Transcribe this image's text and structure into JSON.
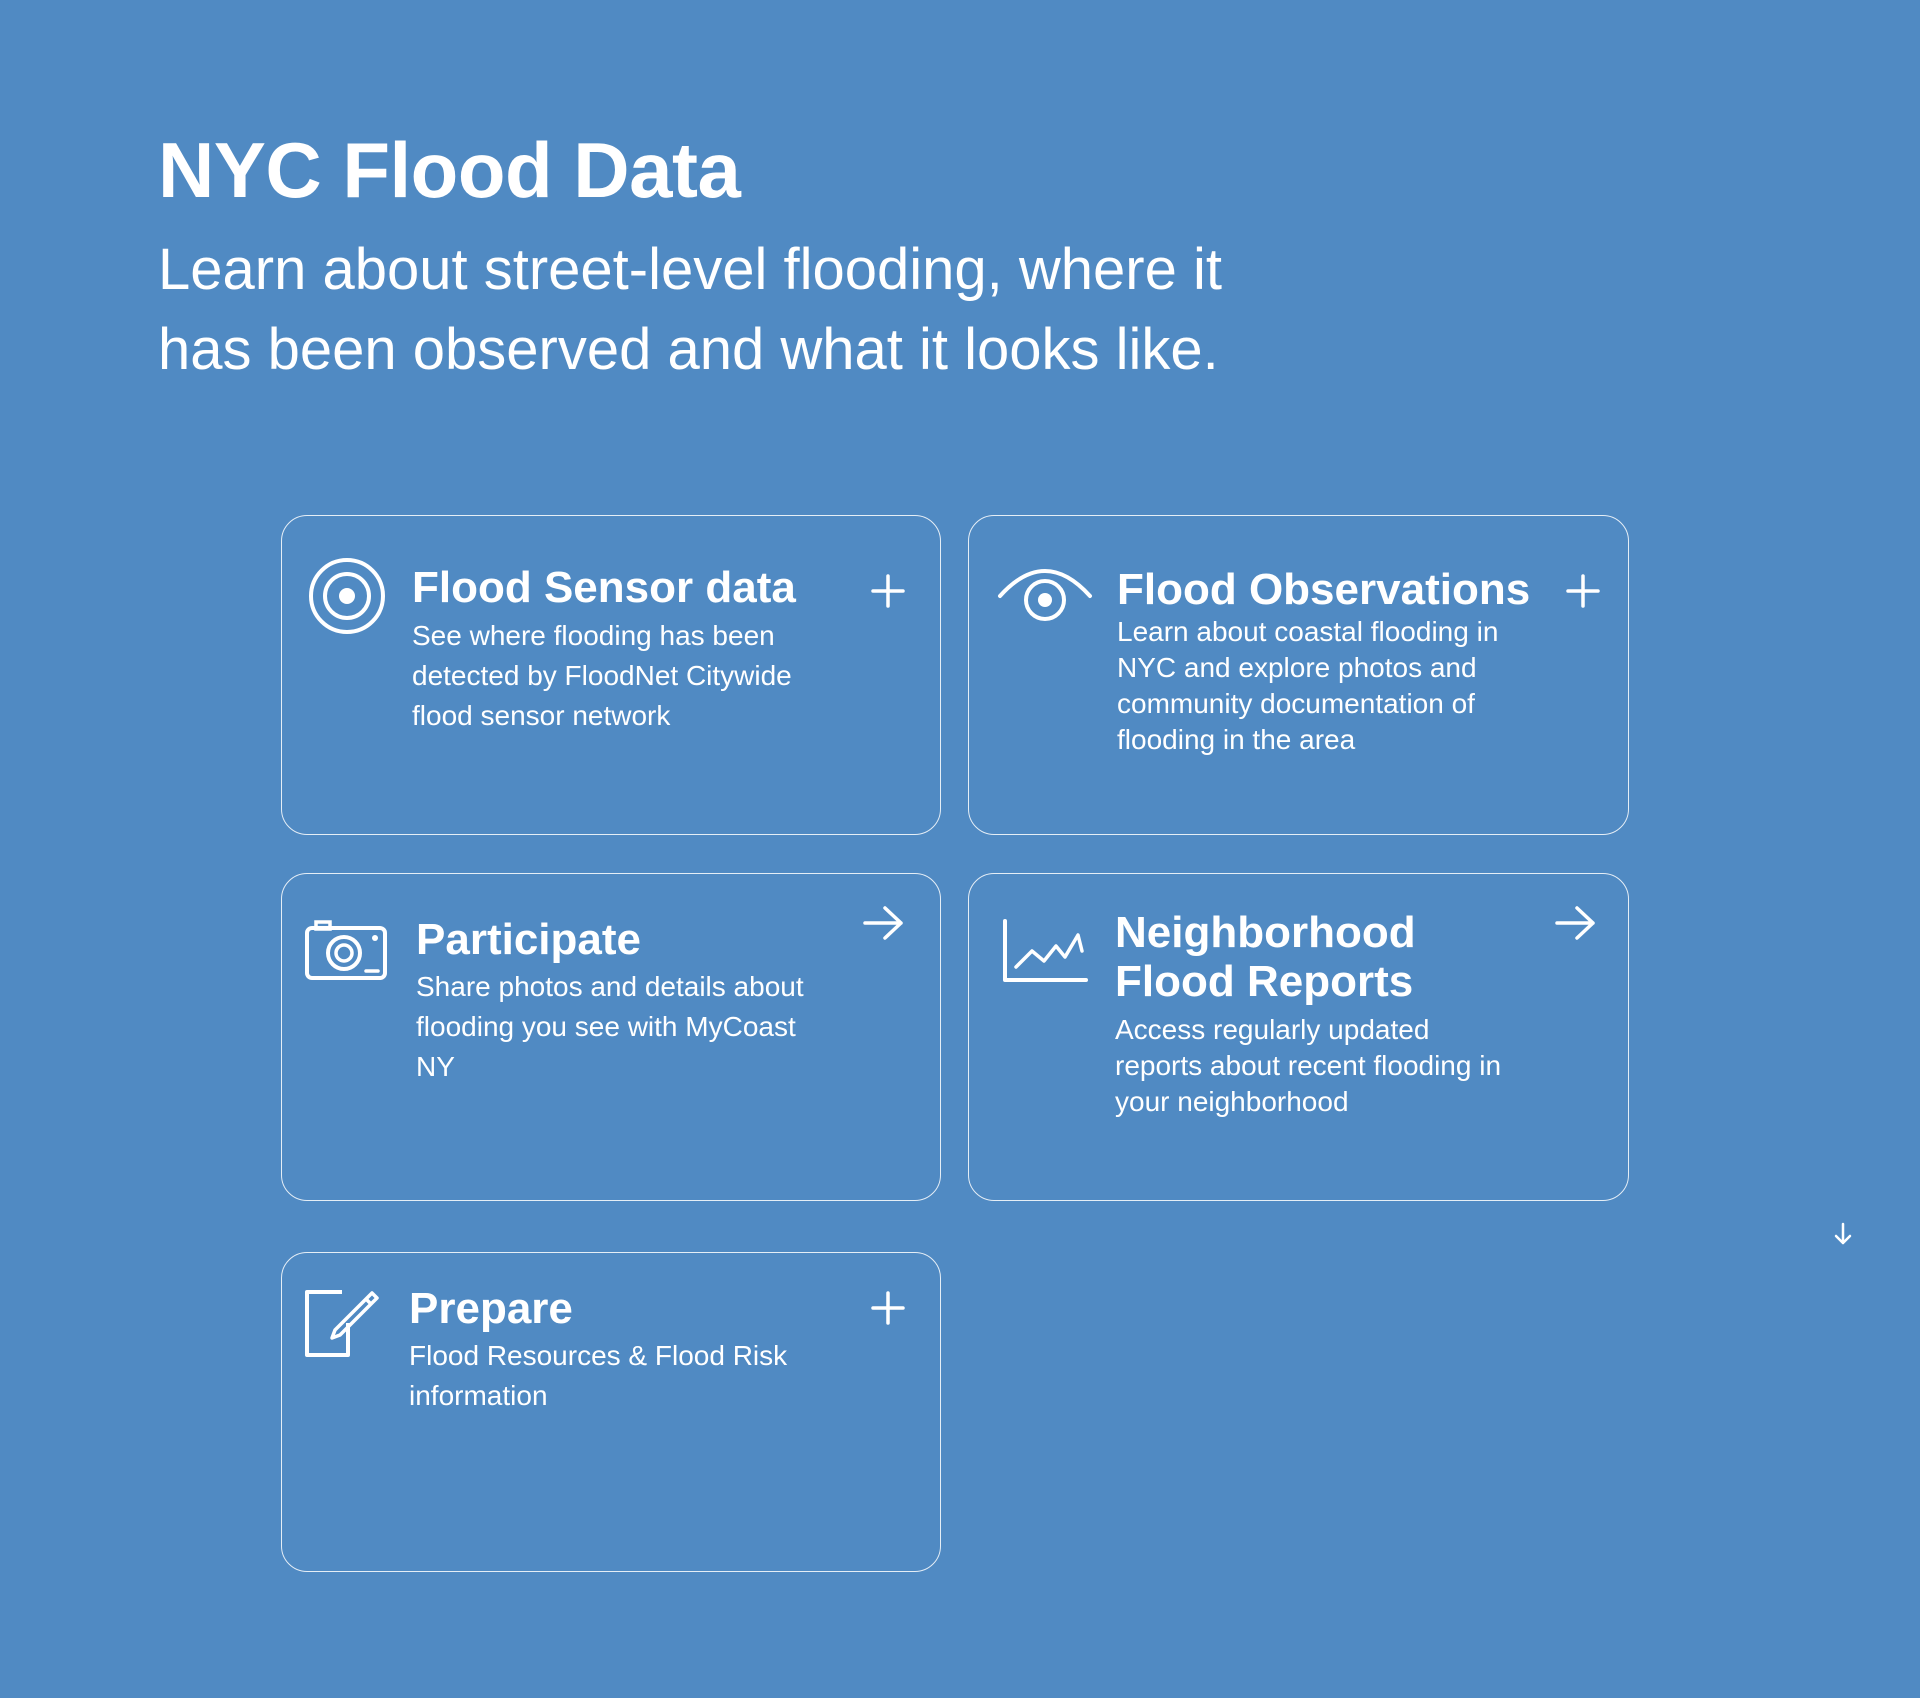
{
  "header": {
    "title": "NYC Flood Data",
    "subtitle": "Learn about street-level flooding, where it has been observed and what it looks like."
  },
  "cards": [
    {
      "title": "Flood Sensor data",
      "description": "See where flooding has been detected by FloodNet Citywide flood sensor network",
      "icon": "target-icon",
      "action": "expand"
    },
    {
      "title": "Flood Observations",
      "description": "Learn about coastal flooding in NYC and explore photos and community documentation of flooding in the area",
      "icon": "eye-icon",
      "action": "expand"
    },
    {
      "title": "Participate",
      "description": "Share photos and details about flooding you see with MyCoast NY",
      "icon": "camera-icon",
      "action": "navigate"
    },
    {
      "title": "Neighborhood Flood Reports",
      "description": "Access regularly updated reports about recent flooding in your neighborhood",
      "icon": "line-chart-icon",
      "action": "navigate"
    },
    {
      "title": "Prepare",
      "description": "Flood Resources & Flood Risk information",
      "icon": "edit-document-icon",
      "action": "expand"
    }
  ],
  "scroll_indicator": {
    "icon": "arrow-down-icon"
  },
  "colors": {
    "background": "#508ac3",
    "foreground": "#ffffff"
  }
}
